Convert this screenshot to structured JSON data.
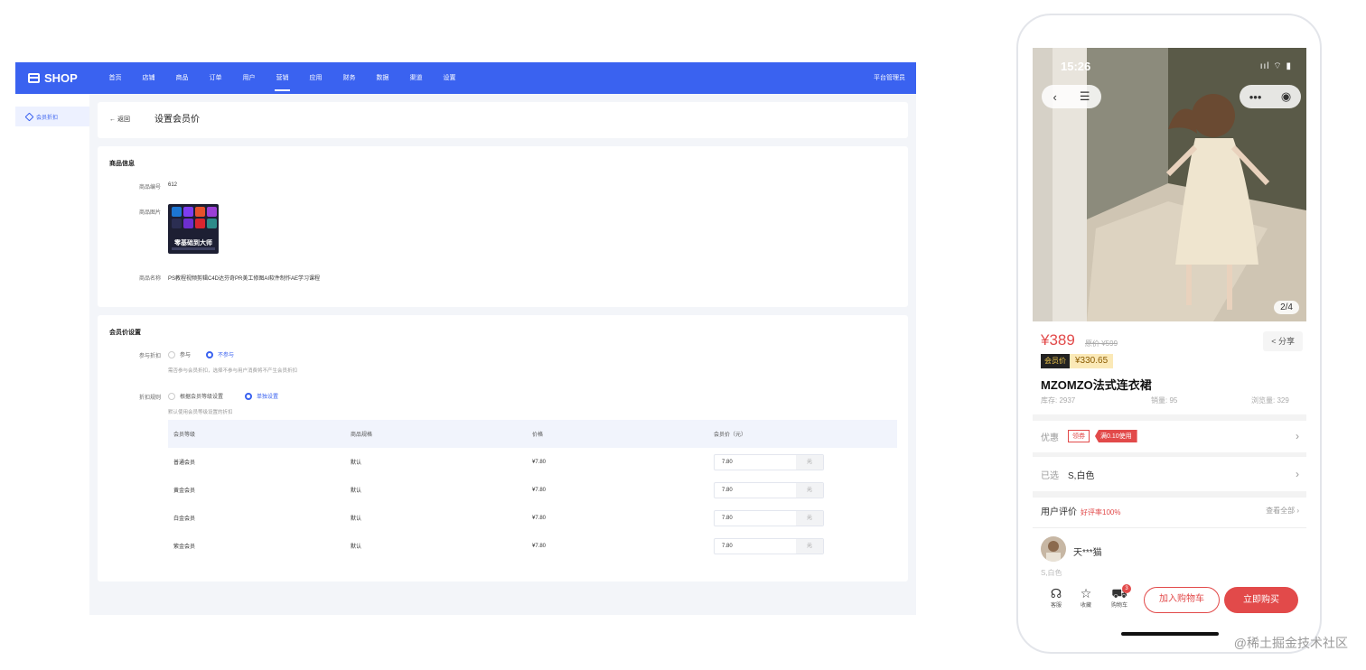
{
  "admin": {
    "logo": "SHOP",
    "nav": [
      "首页",
      "店铺",
      "商品",
      "订单",
      "用户",
      "营销",
      "应用",
      "财务",
      "数据",
      "渠道",
      "设置"
    ],
    "nav_active": "营销",
    "platform": "平台管理员",
    "sidebar_item": "会员折扣",
    "back_label": "← 返回",
    "page_title": "设置会员价",
    "info": {
      "section_title": "商品信息",
      "id_label": "商品编号",
      "id_value": "612",
      "image_label": "商品图片",
      "image_caption": "零基础到大师",
      "name_label": "商品名称",
      "name_value": "PS教程视频剪辑C4D达芬奇PR美工修图AI软件制作AE学习课程"
    },
    "member": {
      "section_title": "会员价设置",
      "join_label": "参与折扣",
      "join_options": [
        "参与",
        "不参与"
      ],
      "join_selected": 1,
      "join_hint": "需否参与会员折扣，选择不参与用户消费将不产生会员折扣",
      "rule_label": "折扣规则",
      "rule_options": [
        "根据会员等级设置",
        "单独设置"
      ],
      "rule_selected": 1,
      "rule_hint": "默认使用会员等级设置的折扣",
      "table": {
        "headers": [
          "会员等级",
          "商品规格",
          "价格",
          "会员价（元）"
        ],
        "rows": [
          {
            "level": "普通会员",
            "spec": "默认",
            "price": "¥7.80",
            "member_price": "7.80"
          },
          {
            "level": "黄金会员",
            "spec": "默认",
            "price": "¥7.80",
            "member_price": "7.80"
          },
          {
            "level": "白金会员",
            "spec": "默认",
            "price": "¥7.80",
            "member_price": "7.80"
          },
          {
            "level": "紫金会员",
            "spec": "默认",
            "price": "¥7.80",
            "member_price": "7.80"
          }
        ],
        "unit": "元"
      }
    }
  },
  "phone": {
    "time": "15:26",
    "status_icons": "ııl ⌔ ▮",
    "image_counter": "2/4",
    "price": "¥389",
    "original_price": "原价 ¥599",
    "share": "分享",
    "member_tag": "会员价",
    "member_price": "¥330.65",
    "title": "MZOMZO法式连衣裙",
    "stock": "库存: 2937",
    "sales": "销量: 95",
    "views": "浏览量: 329",
    "coupon_label": "优惠",
    "coupon_tag": "领券",
    "coupon_value": "满0.10使用",
    "selected_label": "已选",
    "selected_value": "S,白色",
    "review_title": "用户评价",
    "review_rate": "好评率100%",
    "review_all": "查看全部 ›",
    "reviewer": "天***猫",
    "review_spec": "S,白色",
    "bar": {
      "service": "客服",
      "favorite": "收藏",
      "cart": "购物车",
      "cart_count": "3",
      "add_cart": "加入购物车",
      "buy_now": "立即购买"
    }
  },
  "watermark": "@稀土掘金技术社区",
  "colors": {
    "primary": "#3a62f0",
    "accent_red": "#e24a4a",
    "member_gold": "#fbe9b7"
  }
}
